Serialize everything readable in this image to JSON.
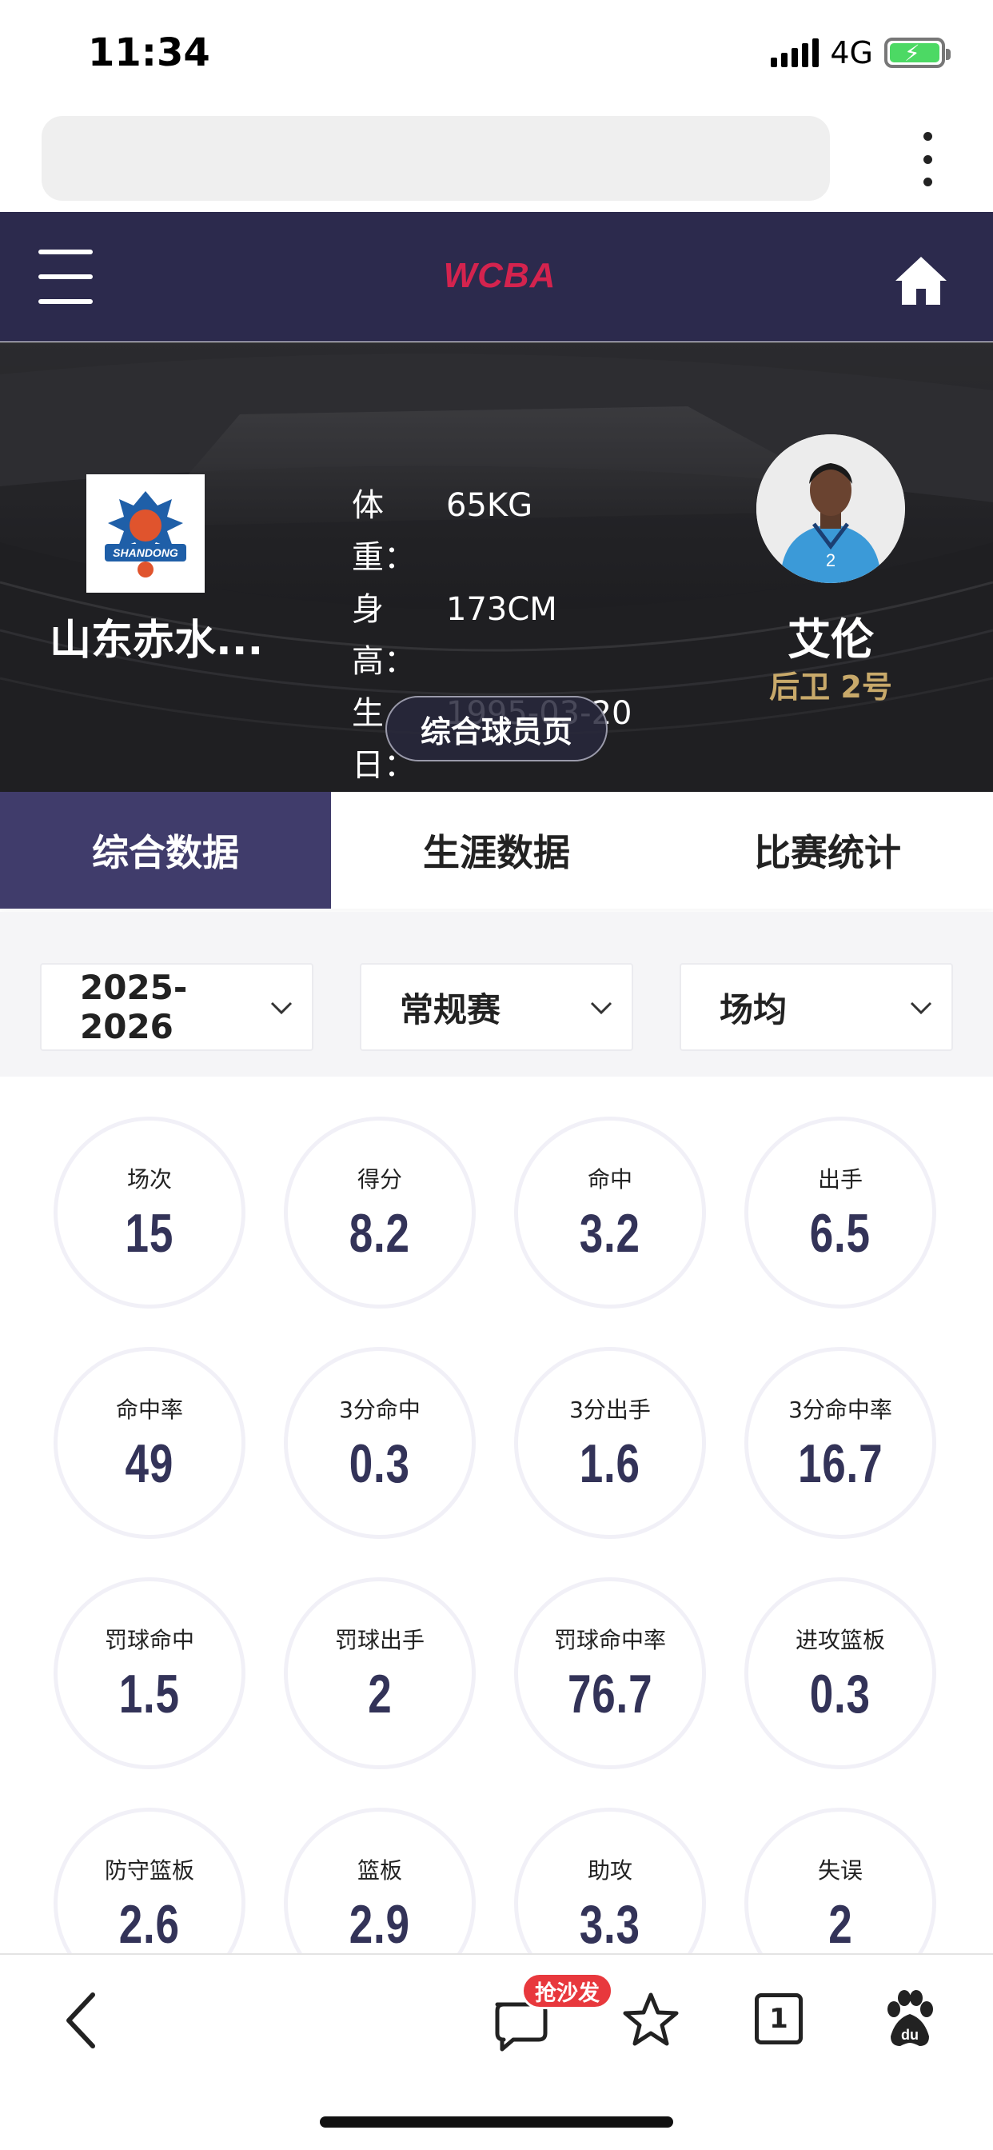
{
  "status_bar": {
    "time": "11:34",
    "network": "4G"
  },
  "header": {
    "logo_text": "WCBA"
  },
  "hero": {
    "team_name": "山东赤水...",
    "team_logo_text": "SHANDONG",
    "info": [
      {
        "label": "体重：",
        "value": "65KG"
      },
      {
        "label": "身高：",
        "value": "173CM"
      },
      {
        "label": "生日：",
        "value": "1995-03-20"
      }
    ],
    "player_name": "艾伦",
    "player_position": "后卫 2号",
    "profile_button": "综合球员页"
  },
  "tabs": [
    {
      "label": "综合数据",
      "active": true
    },
    {
      "label": "生涯数据",
      "active": false
    },
    {
      "label": "比赛统计",
      "active": false
    }
  ],
  "filters": [
    {
      "value": "2025-2026"
    },
    {
      "value": "常规赛"
    },
    {
      "value": "场均"
    }
  ],
  "stats": [
    {
      "label": "场次",
      "value": "15"
    },
    {
      "label": "得分",
      "value": "8.2"
    },
    {
      "label": "命中",
      "value": "3.2"
    },
    {
      "label": "出手",
      "value": "6.5"
    },
    {
      "label": "命中率",
      "value": "49"
    },
    {
      "label": "3分命中",
      "value": "0.3"
    },
    {
      "label": "3分出手",
      "value": "1.6"
    },
    {
      "label": "3分命中率",
      "value": "16.7"
    },
    {
      "label": "罚球命中",
      "value": "1.5"
    },
    {
      "label": "罚球出手",
      "value": "2"
    },
    {
      "label": "罚球命中率",
      "value": "76.7"
    },
    {
      "label": "进攻篮板",
      "value": "0.3"
    },
    {
      "label": "防守篮板",
      "value": "2.6"
    },
    {
      "label": "篮板",
      "value": "2.9"
    },
    {
      "label": "助攻",
      "value": "3.3"
    },
    {
      "label": "失误",
      "value": "2"
    }
  ],
  "toolbar": {
    "comment_badge": "抢沙发",
    "tab_count": "1"
  },
  "colors": {
    "header_bg": "#2c2a4d",
    "active_tab": "#403c6b",
    "accent_red": "#d4234e",
    "position_gold": "#c8a96a",
    "stat_value": "#333358"
  }
}
